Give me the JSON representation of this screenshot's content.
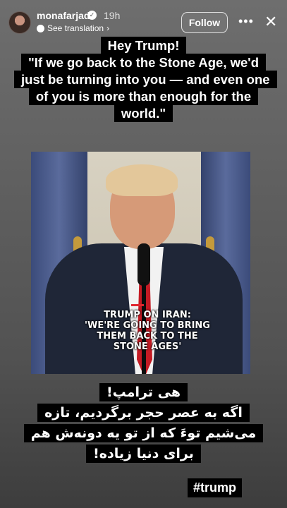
{
  "header": {
    "username": "monafarjad",
    "time": "19h",
    "translation_link": "See translation",
    "follow_label": "Follow",
    "more_icon": "ellipsis-icon",
    "close_icon": "close-icon"
  },
  "story": {
    "caption_top": "Hey Trump!\n\"If we go back to the Stone Age, we'd just be turning into you — and even one of you is more than enough for the world.\"",
    "photo_overlay": "TRUMP ON IRAN:\n'WE'RE GOING TO BRING THEM BACK TO THE STONE AGES'",
    "caption_bottom": "هی ترامپ!\nاگه به عصر حجر برگردیم، تازه می‌شیم توءَ که از تو یه دونه‌ش هم برای دنیا زیاده!",
    "hashtag": "#trump"
  }
}
